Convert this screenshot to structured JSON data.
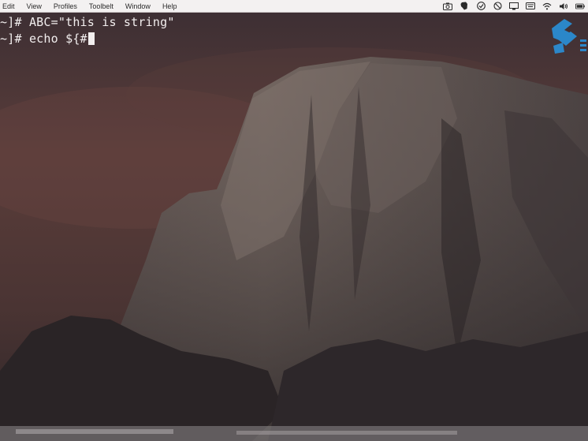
{
  "menubar": {
    "items": [
      "Edit",
      "View",
      "Profiles",
      "Toolbelt",
      "Window",
      "Help"
    ],
    "status_icons": [
      "camera-icon",
      "evernote-icon",
      "notification-icon",
      "sync-icon",
      "display-icon",
      "keyboard-icon",
      "wifi-icon",
      "volume-icon",
      "battery-icon"
    ]
  },
  "terminal": {
    "line1_prompt": "~]#",
    "line1_command": "ABC=\"this is string\"",
    "line2_prompt": "~]#",
    "line2_command": "echo ${#"
  },
  "colors": {
    "terminal_text": "#f2eeee",
    "menubar_bg": "#f3f1f1",
    "logo_blue": "#2a8fd6"
  }
}
